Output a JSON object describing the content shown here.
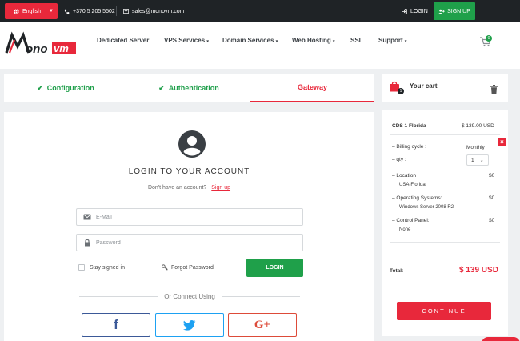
{
  "topbar": {
    "language": "English",
    "phone": "+370 5 205 5502",
    "email": "sales@monovm.com",
    "login": "LOGIN",
    "signup": "SIGN UP"
  },
  "nav": {
    "logo_text": "Monovm",
    "items": [
      "Dedicated Server",
      "VPS Services",
      "Domain Services",
      "Web Hosting",
      "SSL",
      "Support"
    ],
    "cart_count": "0"
  },
  "steps": [
    {
      "label": "Configuration",
      "state": "done"
    },
    {
      "label": "Authentication",
      "state": "done"
    },
    {
      "label": "Gateway",
      "state": "active"
    }
  ],
  "login": {
    "title": "LOGIN TO YOUR ACCOUNT",
    "no_account": "Don't have an account?",
    "signup_link": "Sign up",
    "email_placeholder": "E-Mail",
    "password_placeholder": "Password",
    "stay_signed": "Stay signed in",
    "forgot": "Forgot Password",
    "button": "LOGIN",
    "connect": "Or Connect Using"
  },
  "social": [
    {
      "name": "facebook",
      "glyph": "f",
      "color": "#3b5998"
    },
    {
      "name": "twitter",
      "glyph": "",
      "color": "#1da1f2"
    },
    {
      "name": "google-plus",
      "glyph": "G+",
      "color": "#dd4b39"
    }
  ],
  "cart": {
    "title": "Your cart",
    "badge": "1",
    "product": "CDS 1 Florida",
    "product_price": "$ 139.00 USD",
    "billing_label": "– Billing cycle :",
    "billing_value": "Monthly",
    "qty_label": "– qty :",
    "qty_value": "1",
    "location_label": "– Location :",
    "location_price": "$0",
    "location_value": "USA-Florida",
    "os_label": "– Operating Systems:",
    "os_price": "$0",
    "os_value": "Windows Server 2008 R2",
    "cp_label": "– Control Panel:",
    "cp_price": "$0",
    "cp_value": "None",
    "total_label": "Total:",
    "total_value": "$ 139 USD",
    "continue": "CONTINUE"
  },
  "colors": {
    "accent": "#e8283b",
    "success": "#1fa04a",
    "dark": "#1f2326"
  }
}
